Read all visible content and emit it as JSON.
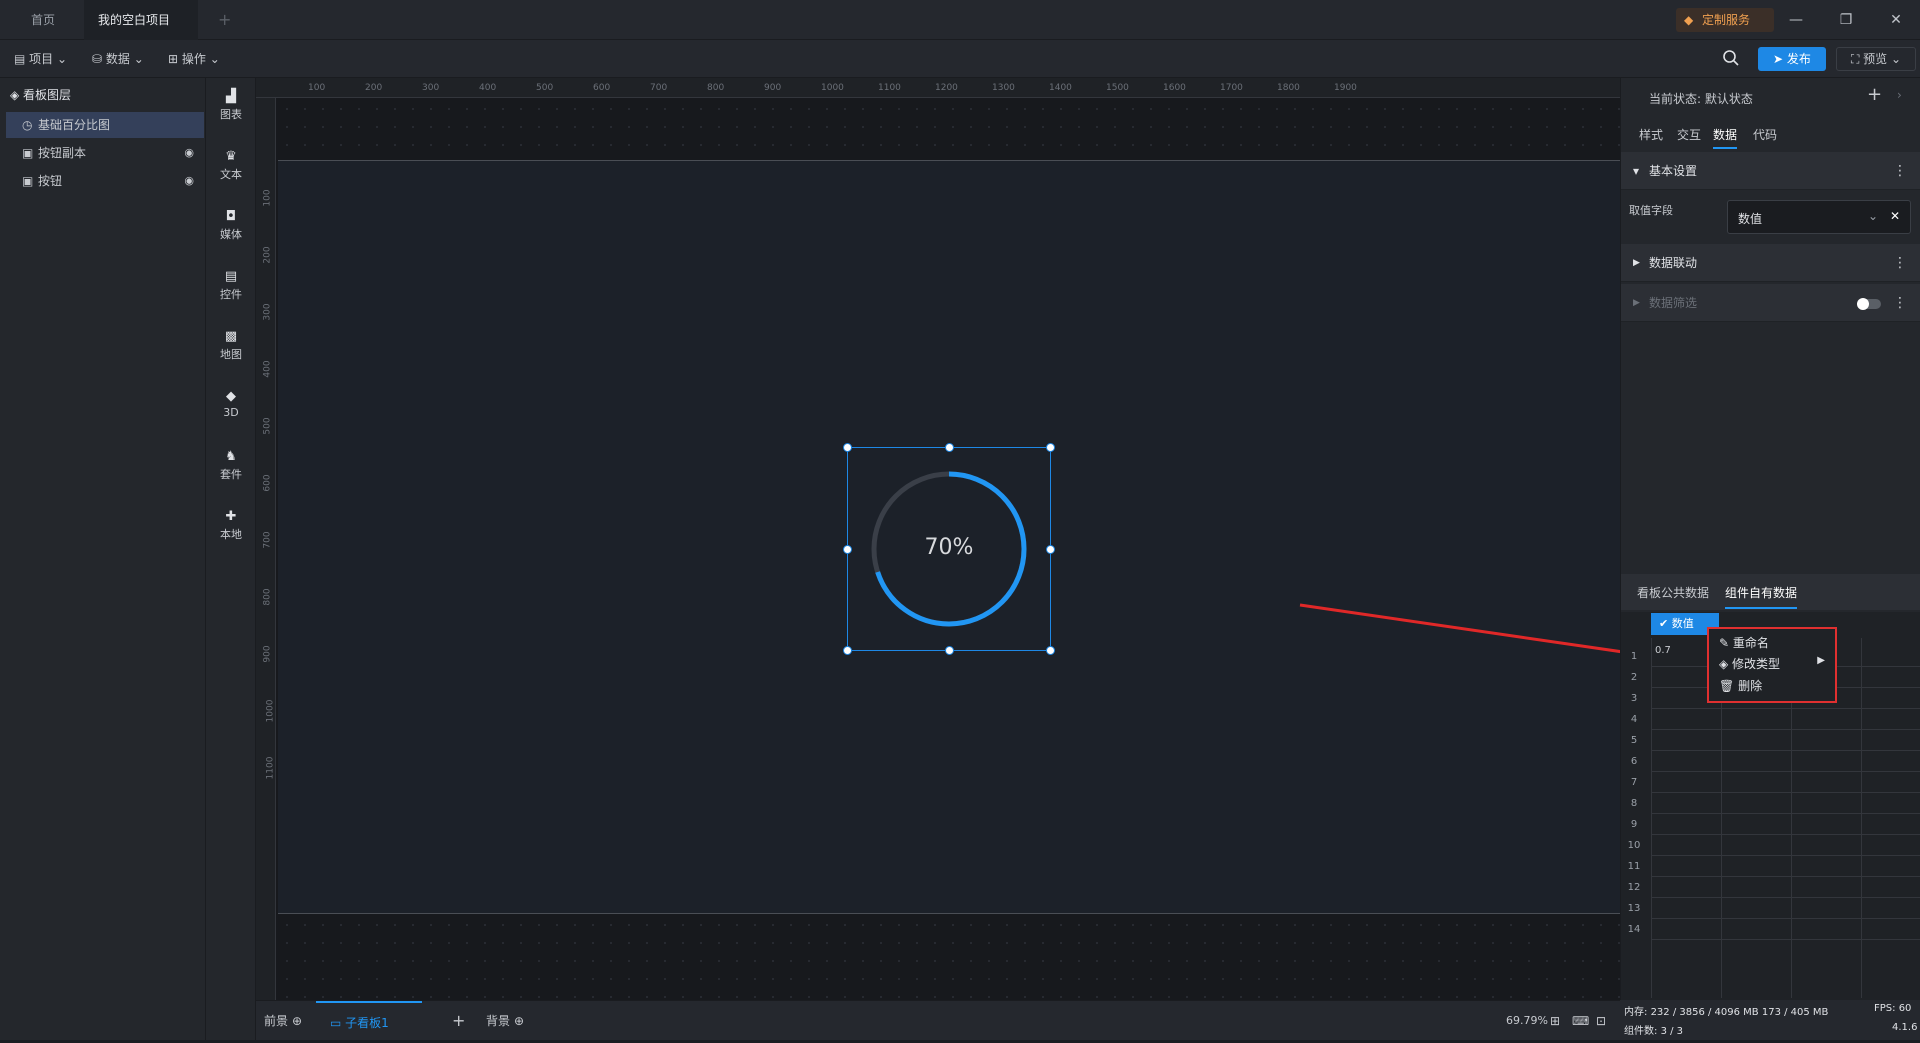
{
  "titlebar": {
    "tabs": [
      {
        "label": "首页"
      },
      {
        "label": "我的空白项目",
        "modified": true
      }
    ],
    "new_tab": "+",
    "custom_service": "定制服务",
    "minimize": "—",
    "restore": "❐",
    "close": "✕"
  },
  "toolbar": {
    "menus": [
      "项目",
      "数据",
      "操作"
    ],
    "publish_label": "发布",
    "preview_label": "预览"
  },
  "layers": {
    "title": "看板图层",
    "items": [
      {
        "label": "基础百分比图",
        "selected": true
      },
      {
        "label": "按钮副本",
        "hidden": true
      },
      {
        "label": "按钮",
        "hidden": true
      }
    ]
  },
  "components": [
    {
      "label": "图表",
      "icon": "bar-chart-icon"
    },
    {
      "label": "文本",
      "icon": "text-icon"
    },
    {
      "label": "媒体",
      "icon": "media-icon"
    },
    {
      "label": "控件",
      "icon": "control-icon"
    },
    {
      "label": "地图",
      "icon": "map-icon"
    },
    {
      "label": "3D",
      "icon": "cube-icon"
    },
    {
      "label": "套件",
      "icon": "kit-icon"
    },
    {
      "label": "本地",
      "icon": "puzzle-icon"
    }
  ],
  "ruler": {
    "top_ticks": [
      "100",
      "200",
      "300",
      "400",
      "500",
      "600",
      "700",
      "800",
      "900",
      "1000",
      "1100",
      "1200",
      "1300",
      "1400",
      "1500",
      "1600",
      "1700",
      "1800",
      "1900"
    ],
    "left_ticks": [
      "100",
      "200",
      "300",
      "400",
      "500",
      "600",
      "700",
      "800",
      "900",
      "1000",
      "1100"
    ]
  },
  "widget": {
    "percent_label": "70%",
    "percent_value": 0.7,
    "track_color": "#3a3f48",
    "arc_color": "#2196f3"
  },
  "bottombar": {
    "front": "前景",
    "sub_board": "子看板1",
    "add": "+",
    "background": "背景",
    "zoom": "69.79%"
  },
  "rightpanel": {
    "state_label": "当前状态:",
    "state_value": "默认状态",
    "tabs": [
      "样式",
      "交互",
      "数据",
      "代码"
    ],
    "active_tab": "数据",
    "basic_settings": "基本设置",
    "field_label": "取值字段",
    "field_value": "数值",
    "data_link": "数据联动",
    "data_filter": "数据筛选",
    "data_tabs": [
      "看板公共数据",
      "组件自有数据"
    ],
    "active_data_tab": "组件自有数据",
    "column_header": "数值",
    "first_cell": "0.7",
    "row_numbers": [
      "1",
      "2",
      "3",
      "4",
      "5",
      "6",
      "7",
      "8",
      "9",
      "10",
      "11",
      "12",
      "13",
      "14"
    ],
    "context_menu": [
      "重命名",
      "修改类型",
      "删除"
    ]
  },
  "status": {
    "memory_label": "内存:",
    "memory_value": "232 / 3856 / 4096 MB  173 / 405 MB",
    "fps_label": "FPS:",
    "fps_value": "60",
    "components_label": "组件数:",
    "components_value": "3 / 3",
    "version": "4.1.6"
  }
}
